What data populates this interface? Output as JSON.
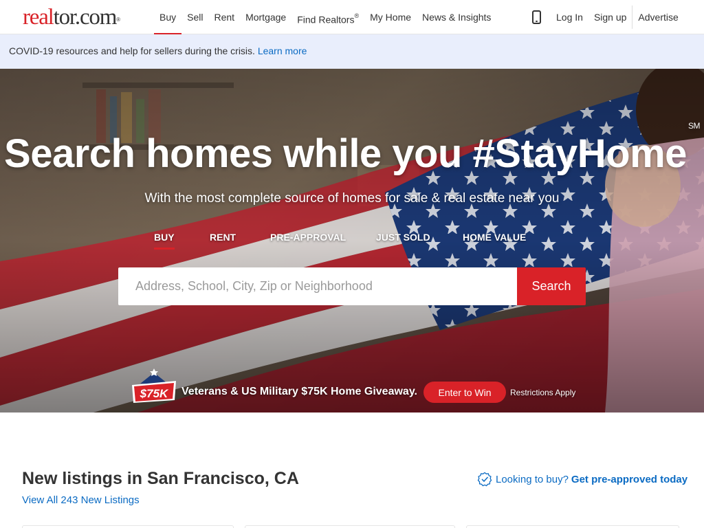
{
  "header": {
    "logo_red": "real",
    "logo_dark": "tor.com",
    "logo_reg": "®",
    "nav": [
      {
        "label": "Buy",
        "active": true
      },
      {
        "label": "Sell"
      },
      {
        "label": "Rent"
      },
      {
        "label": "Mortgage"
      },
      {
        "label": "Find Realtors",
        "sup": "®"
      },
      {
        "label": "My Home"
      },
      {
        "label": "News & Insights"
      }
    ],
    "login": "Log In",
    "signup": "Sign up",
    "advertise": "Advertise"
  },
  "banner": {
    "text": "COVID-19 resources and help for sellers during the crisis.",
    "link": "Learn more"
  },
  "hero": {
    "title": "Search homes while you #StayHome",
    "title_sup": "SM",
    "subtitle": "With the most complete source of homes for sale & real estate near you",
    "tabs": [
      {
        "label": "BUY",
        "active": true
      },
      {
        "label": "RENT"
      },
      {
        "label": "PRE-APPROVAL"
      },
      {
        "label": "JUST SOLD"
      },
      {
        "label": "HOME VALUE"
      }
    ],
    "search_placeholder": "Address, School, City, Zip or Neighborhood",
    "search_button": "Search",
    "promo_badge": "$75K",
    "promo_text": "Veterans & US Military $75K Home Giveaway.",
    "enter_button": "Enter to Win",
    "restrictions": "Restrictions Apply"
  },
  "listings": {
    "title": "New listings in San Francisco, CA",
    "view_all": "View All 243 New Listings",
    "preapproval_question": "Looking to buy?",
    "preapproval_cta": "Get pre-approved today"
  },
  "colors": {
    "brand_red": "#d92228",
    "link_blue": "#0b6bc3",
    "banner_bg": "#e9eefc"
  }
}
